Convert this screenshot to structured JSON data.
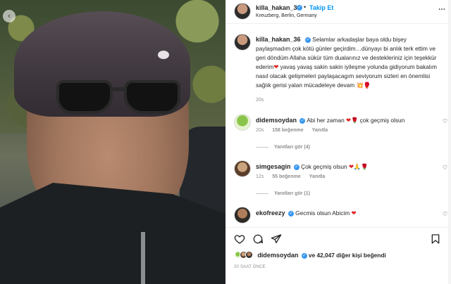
{
  "post": {
    "username": "killa_hakan_36",
    "follow_label": "Takip Et",
    "location": "Kreuzberg, Berlin, Germany",
    "caption_parts": {
      "p1": "Selamlar arkadaşlar baya oldu bişey paylaşmadım çok kötü günler geçirdim…dünyayı bi anlık terk ettim ve geri döndüm Allaha sükür tüm dualarınız ve destekleriniz için teşekkür ederim",
      "heart": "❤",
      "p2": "yavaş yavaş sakin sakin iyileşme yolunda gidiyorum bakalım nasıl olacak gelişmeleri paylaşacagım seviyorum sizleri en önemlisi sağlık gerisi yalan mücadeleye devam",
      "emoji": "💥🥊"
    },
    "caption_time": "20s"
  },
  "comments": [
    {
      "username": "didemsoydan",
      "text": "Abi her zaman",
      "emoji": "❤🌹",
      "text2": "çok geçmiş olsun",
      "time": "20s",
      "likes": "158 beğenme",
      "reply": "Yanıtla",
      "view_replies": "Yanıtları gör (4)"
    },
    {
      "username": "simgesagin",
      "text": "Çok geçmiş olsun",
      "emoji": "❤🙏🌹",
      "time": "12s",
      "likes": "55 beğenme",
      "reply": "Yanıtla",
      "view_replies": "Yanıtları gör (1)"
    },
    {
      "username": "ekofreezy",
      "text": "Gecmis olsun Abicim",
      "emoji": "❤"
    }
  ],
  "likes": {
    "first_liker": "didemsoydan",
    "rest": "ve 42,047 diğer kişi beğendi"
  },
  "date_label": "20 SAAT ÖNCE",
  "colors": {
    "link": "#0095f6",
    "verified": "#3897f0",
    "heart": "#e02424"
  },
  "icons": {
    "actions": [
      "heart-icon",
      "comment-icon",
      "share-icon",
      "bookmark-icon"
    ],
    "more": "more-icon"
  }
}
